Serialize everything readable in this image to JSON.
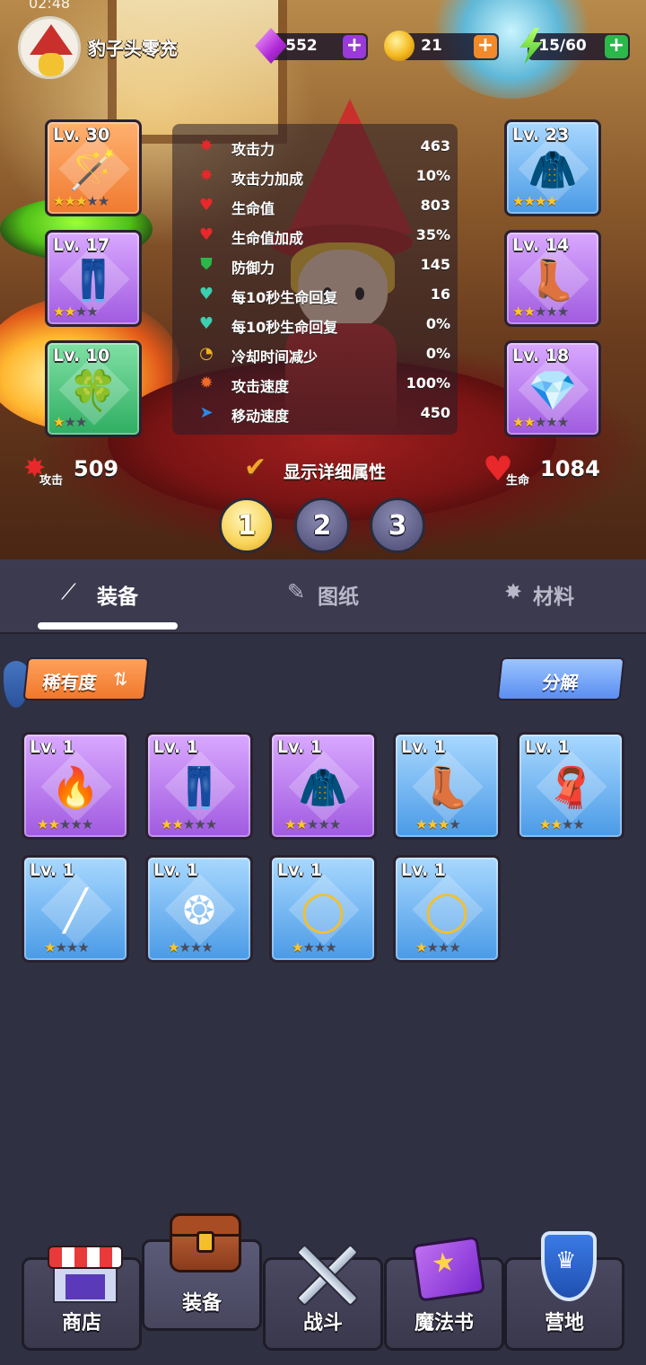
{
  "status_bar": {
    "time": "02:48"
  },
  "header": {
    "username": "豹子头零充",
    "gems": "552",
    "coins": "21",
    "energy": "15/60"
  },
  "equipped": {
    "left": [
      {
        "level": "Lv. 30",
        "stars": 3,
        "max_stars": 5,
        "rarity": "orange",
        "icon": "staff-icon"
      },
      {
        "level": "Lv. 17",
        "stars": 2,
        "max_stars": 4,
        "rarity": "purple",
        "icon": "pants-icon"
      },
      {
        "level": "Lv. 10",
        "stars": 1,
        "max_stars": 3,
        "rarity": "green",
        "icon": "clover-icon"
      }
    ],
    "right": [
      {
        "level": "Lv. 23",
        "stars": 4,
        "max_stars": 4,
        "rarity": "blue",
        "icon": "cape-icon"
      },
      {
        "level": "Lv. 14",
        "stars": 2,
        "max_stars": 5,
        "rarity": "purple",
        "icon": "boots-icon"
      },
      {
        "level": "Lv. 18",
        "stars": 2,
        "max_stars": 5,
        "rarity": "purple",
        "icon": "crystal-icon"
      }
    ]
  },
  "stats": [
    {
      "label": "攻击力",
      "value": "463",
      "icon": "attack-icon"
    },
    {
      "label": "攻击力加成",
      "value": "10%",
      "icon": "attack-bonus-icon"
    },
    {
      "label": "生命值",
      "value": "803",
      "icon": "heart-icon"
    },
    {
      "label": "生命值加成",
      "value": "35%",
      "icon": "heart-bonus-icon"
    },
    {
      "label": "防御力",
      "value": "145",
      "icon": "shield-icon"
    },
    {
      "label": "每10秒生命回复",
      "value": "16",
      "icon": "regen-icon"
    },
    {
      "label": "每10秒生命回复",
      "value": "0%",
      "icon": "regen-bonus-icon"
    },
    {
      "label": "冷却时间减少",
      "value": "0%",
      "icon": "cooldown-icon"
    },
    {
      "label": "攻击速度",
      "value": "100%",
      "icon": "attack-speed-icon"
    },
    {
      "label": "移动速度",
      "value": "450",
      "icon": "move-speed-icon"
    }
  ],
  "summary": {
    "attack_label": "攻击",
    "attack_value": "509",
    "life_label": "生命",
    "life_value": "1084",
    "detail_toggle_label": "显示详细属性"
  },
  "loadout_pages": [
    "1",
    "2",
    "3"
  ],
  "active_page": "1",
  "tabs": [
    {
      "label": "装备",
      "icon": "wand-icon",
      "active": true
    },
    {
      "label": "图纸",
      "icon": "scroll-icon",
      "active": false
    },
    {
      "label": "材料",
      "icon": "sparkle-icon",
      "active": false
    }
  ],
  "inventory": {
    "sort_label": "稀有度",
    "decompose_label": "分解",
    "items": [
      {
        "level": "Lv. 1",
        "stars": 2,
        "max_stars": 5,
        "rarity": "purple",
        "icon": "torch-staff-icon"
      },
      {
        "level": "Lv. 1",
        "stars": 2,
        "max_stars": 5,
        "rarity": "purple",
        "icon": "pants-icon"
      },
      {
        "level": "Lv. 1",
        "stars": 2,
        "max_stars": 5,
        "rarity": "purple",
        "icon": "robe-icon"
      },
      {
        "level": "Lv. 1",
        "stars": 3,
        "max_stars": 4,
        "rarity": "blue",
        "icon": "boots-icon"
      },
      {
        "level": "Lv. 1",
        "stars": 2,
        "max_stars": 4,
        "rarity": "blue",
        "icon": "cape-icon"
      },
      {
        "level": "Lv. 1",
        "stars": 1,
        "max_stars": 4,
        "rarity": "blue",
        "icon": "spear-icon"
      },
      {
        "level": "Lv. 1",
        "stars": 1,
        "max_stars": 4,
        "rarity": "blue",
        "icon": "emblem-icon"
      },
      {
        "level": "Lv. 1",
        "stars": 1,
        "max_stars": 4,
        "rarity": "blue",
        "icon": "ring-icon"
      },
      {
        "level": "Lv. 1",
        "stars": 1,
        "max_stars": 4,
        "rarity": "blue",
        "icon": "ring-icon"
      }
    ]
  },
  "bottom_nav": [
    {
      "label": "商店",
      "icon": "shop-icon",
      "active": false
    },
    {
      "label": "装备",
      "icon": "bag-icon",
      "active": true
    },
    {
      "label": "战斗",
      "icon": "swords-icon",
      "active": false
    },
    {
      "label": "魔法书",
      "icon": "spellbook-icon",
      "active": false
    },
    {
      "label": "营地",
      "icon": "camp-shield-icon",
      "active": false
    }
  ]
}
